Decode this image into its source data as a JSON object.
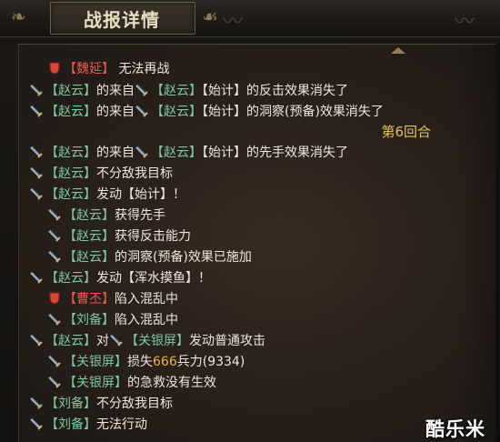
{
  "header": {
    "title": "战报详情"
  },
  "colors": {
    "name_green": "#7fc7a2",
    "name_red": "#ee5a4f",
    "text": "#ece7dc",
    "number_orange": "#f0b23a",
    "round_gold": "#e3c35d"
  },
  "log": {
    "lines": [
      {
        "icon": "red-shield-icon",
        "parts": [
          {
            "t": "【魏延】",
            "c": "red"
          },
          {
            "t": " 无法再战",
            "c": "text"
          }
        ]
      },
      {
        "icon": "sword-icon",
        "parts": [
          {
            "t": "【赵云】",
            "c": "green"
          },
          {
            "t": "的来自",
            "c": "text"
          },
          {
            "icon": "sword-icon"
          },
          {
            "t": "【赵云】",
            "c": "green"
          },
          {
            "t": "【始计】的反击效果消失了",
            "c": "text"
          }
        ]
      },
      {
        "icon": "sword-icon",
        "parts": [
          {
            "t": "【赵云】",
            "c": "green"
          },
          {
            "t": "的来自",
            "c": "text"
          },
          {
            "icon": "sword-icon"
          },
          {
            "t": "【赵云】",
            "c": "green"
          },
          {
            "t": "【始计】的洞察(预备)效果消失了",
            "c": "text"
          }
        ]
      },
      {
        "icon": "sword-icon",
        "parts": [
          {
            "t": "【赵云】",
            "c": "green"
          },
          {
            "t": "的来自",
            "c": "text"
          },
          {
            "icon": "sword-icon"
          },
          {
            "t": "【赵云】",
            "c": "green"
          },
          {
            "t": "【始计】的先手效果消失了",
            "c": "text"
          }
        ]
      },
      {
        "icon": "sword-icon",
        "parts": [
          {
            "t": "【赵云】",
            "c": "green"
          },
          {
            "t": "不分敌我目标",
            "c": "text"
          }
        ]
      },
      {
        "icon": "sword-icon",
        "parts": [
          {
            "t": "【赵云】",
            "c": "green"
          },
          {
            "t": "发动【始计】！",
            "c": "text"
          }
        ]
      },
      {
        "icon": "sword-icon",
        "parts": [
          {
            "t": "【赵云】",
            "c": "green"
          },
          {
            "t": "获得先手",
            "c": "text"
          }
        ]
      },
      {
        "icon": "sword-icon",
        "parts": [
          {
            "t": "【赵云】",
            "c": "green"
          },
          {
            "t": "获得反击能力",
            "c": "text"
          }
        ]
      },
      {
        "icon": "sword-icon",
        "parts": [
          {
            "t": "【赵云】",
            "c": "green"
          },
          {
            "t": "的洞察(预备)效果已施加",
            "c": "text"
          }
        ]
      },
      {
        "icon": "sword-icon",
        "parts": [
          {
            "t": "【赵云】",
            "c": "green"
          },
          {
            "t": "发动【浑水摸鱼】！",
            "c": "text"
          }
        ]
      },
      {
        "icon": "red-shield-icon",
        "parts": [
          {
            "t": "【曹丕】",
            "c": "red"
          },
          {
            "t": "陷入混乱中",
            "c": "text"
          }
        ]
      },
      {
        "icon": "sword-icon",
        "parts": [
          {
            "t": "【刘备】",
            "c": "green"
          },
          {
            "t": "陷入混乱中",
            "c": "text"
          }
        ]
      },
      {
        "icon": "sword-icon",
        "parts": [
          {
            "t": "【赵云】",
            "c": "green"
          },
          {
            "t": "对",
            "c": "text"
          },
          {
            "icon": "sword-icon"
          },
          {
            "t": "【关银屏】",
            "c": "green"
          },
          {
            "t": "发动普通攻击",
            "c": "text"
          }
        ]
      },
      {
        "icon": "sword-icon",
        "parts": [
          {
            "t": "【关银屏】",
            "c": "green"
          },
          {
            "t": "损失",
            "c": "text"
          },
          {
            "t": "666",
            "c": "num"
          },
          {
            "t": "兵力(9334)",
            "c": "text"
          }
        ]
      },
      {
        "icon": "sword-icon",
        "parts": [
          {
            "t": "【关银屏】",
            "c": "green"
          },
          {
            "t": "的急救没有生效",
            "c": "text"
          }
        ]
      },
      {
        "icon": "sword-icon",
        "parts": [
          {
            "t": "【刘备】",
            "c": "green"
          },
          {
            "t": "不分敌我目标",
            "c": "text"
          }
        ]
      },
      {
        "icon": "sword-icon",
        "parts": [
          {
            "t": "【刘备】",
            "c": "green"
          },
          {
            "t": "无法行动",
            "c": "text"
          }
        ]
      }
    ],
    "round_label": "第6回合"
  },
  "watermark": "酷乐米"
}
